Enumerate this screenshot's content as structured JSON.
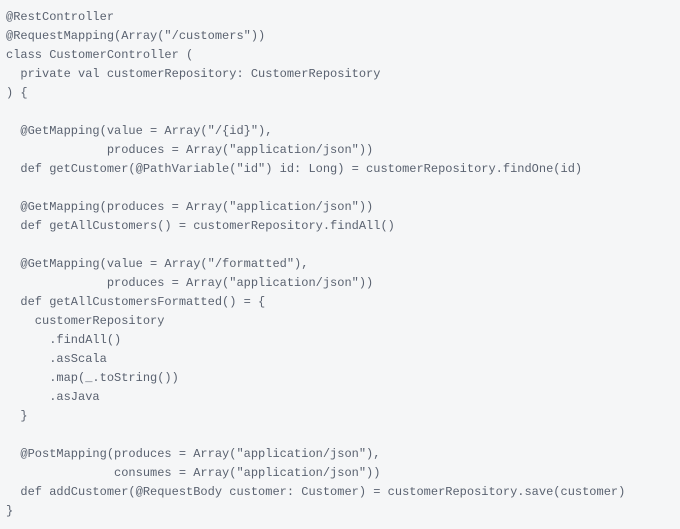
{
  "code": {
    "lines": [
      "@RestController",
      "@RequestMapping(Array(\"/customers\"))",
      "class CustomerController (",
      "  private val customerRepository: CustomerRepository",
      ") {",
      "",
      "  @GetMapping(value = Array(\"/{id}\"),",
      "              produces = Array(\"application/json\"))",
      "  def getCustomer(@PathVariable(\"id\") id: Long) = customerRepository.findOne(id)",
      "",
      "  @GetMapping(produces = Array(\"application/json\"))",
      "  def getAllCustomers() = customerRepository.findAll()",
      "",
      "  @GetMapping(value = Array(\"/formatted\"),",
      "              produces = Array(\"application/json\"))",
      "  def getAllCustomersFormatted() = {",
      "    customerRepository",
      "      .findAll()",
      "      .asScala",
      "      .map(_.toString())",
      "      .asJava",
      "  }",
      "",
      "  @PostMapping(produces = Array(\"application/json\"),",
      "               consumes = Array(\"application/json\"))",
      "  def addCustomer(@RequestBody customer: Customer) = customerRepository.save(customer)",
      "}"
    ]
  }
}
